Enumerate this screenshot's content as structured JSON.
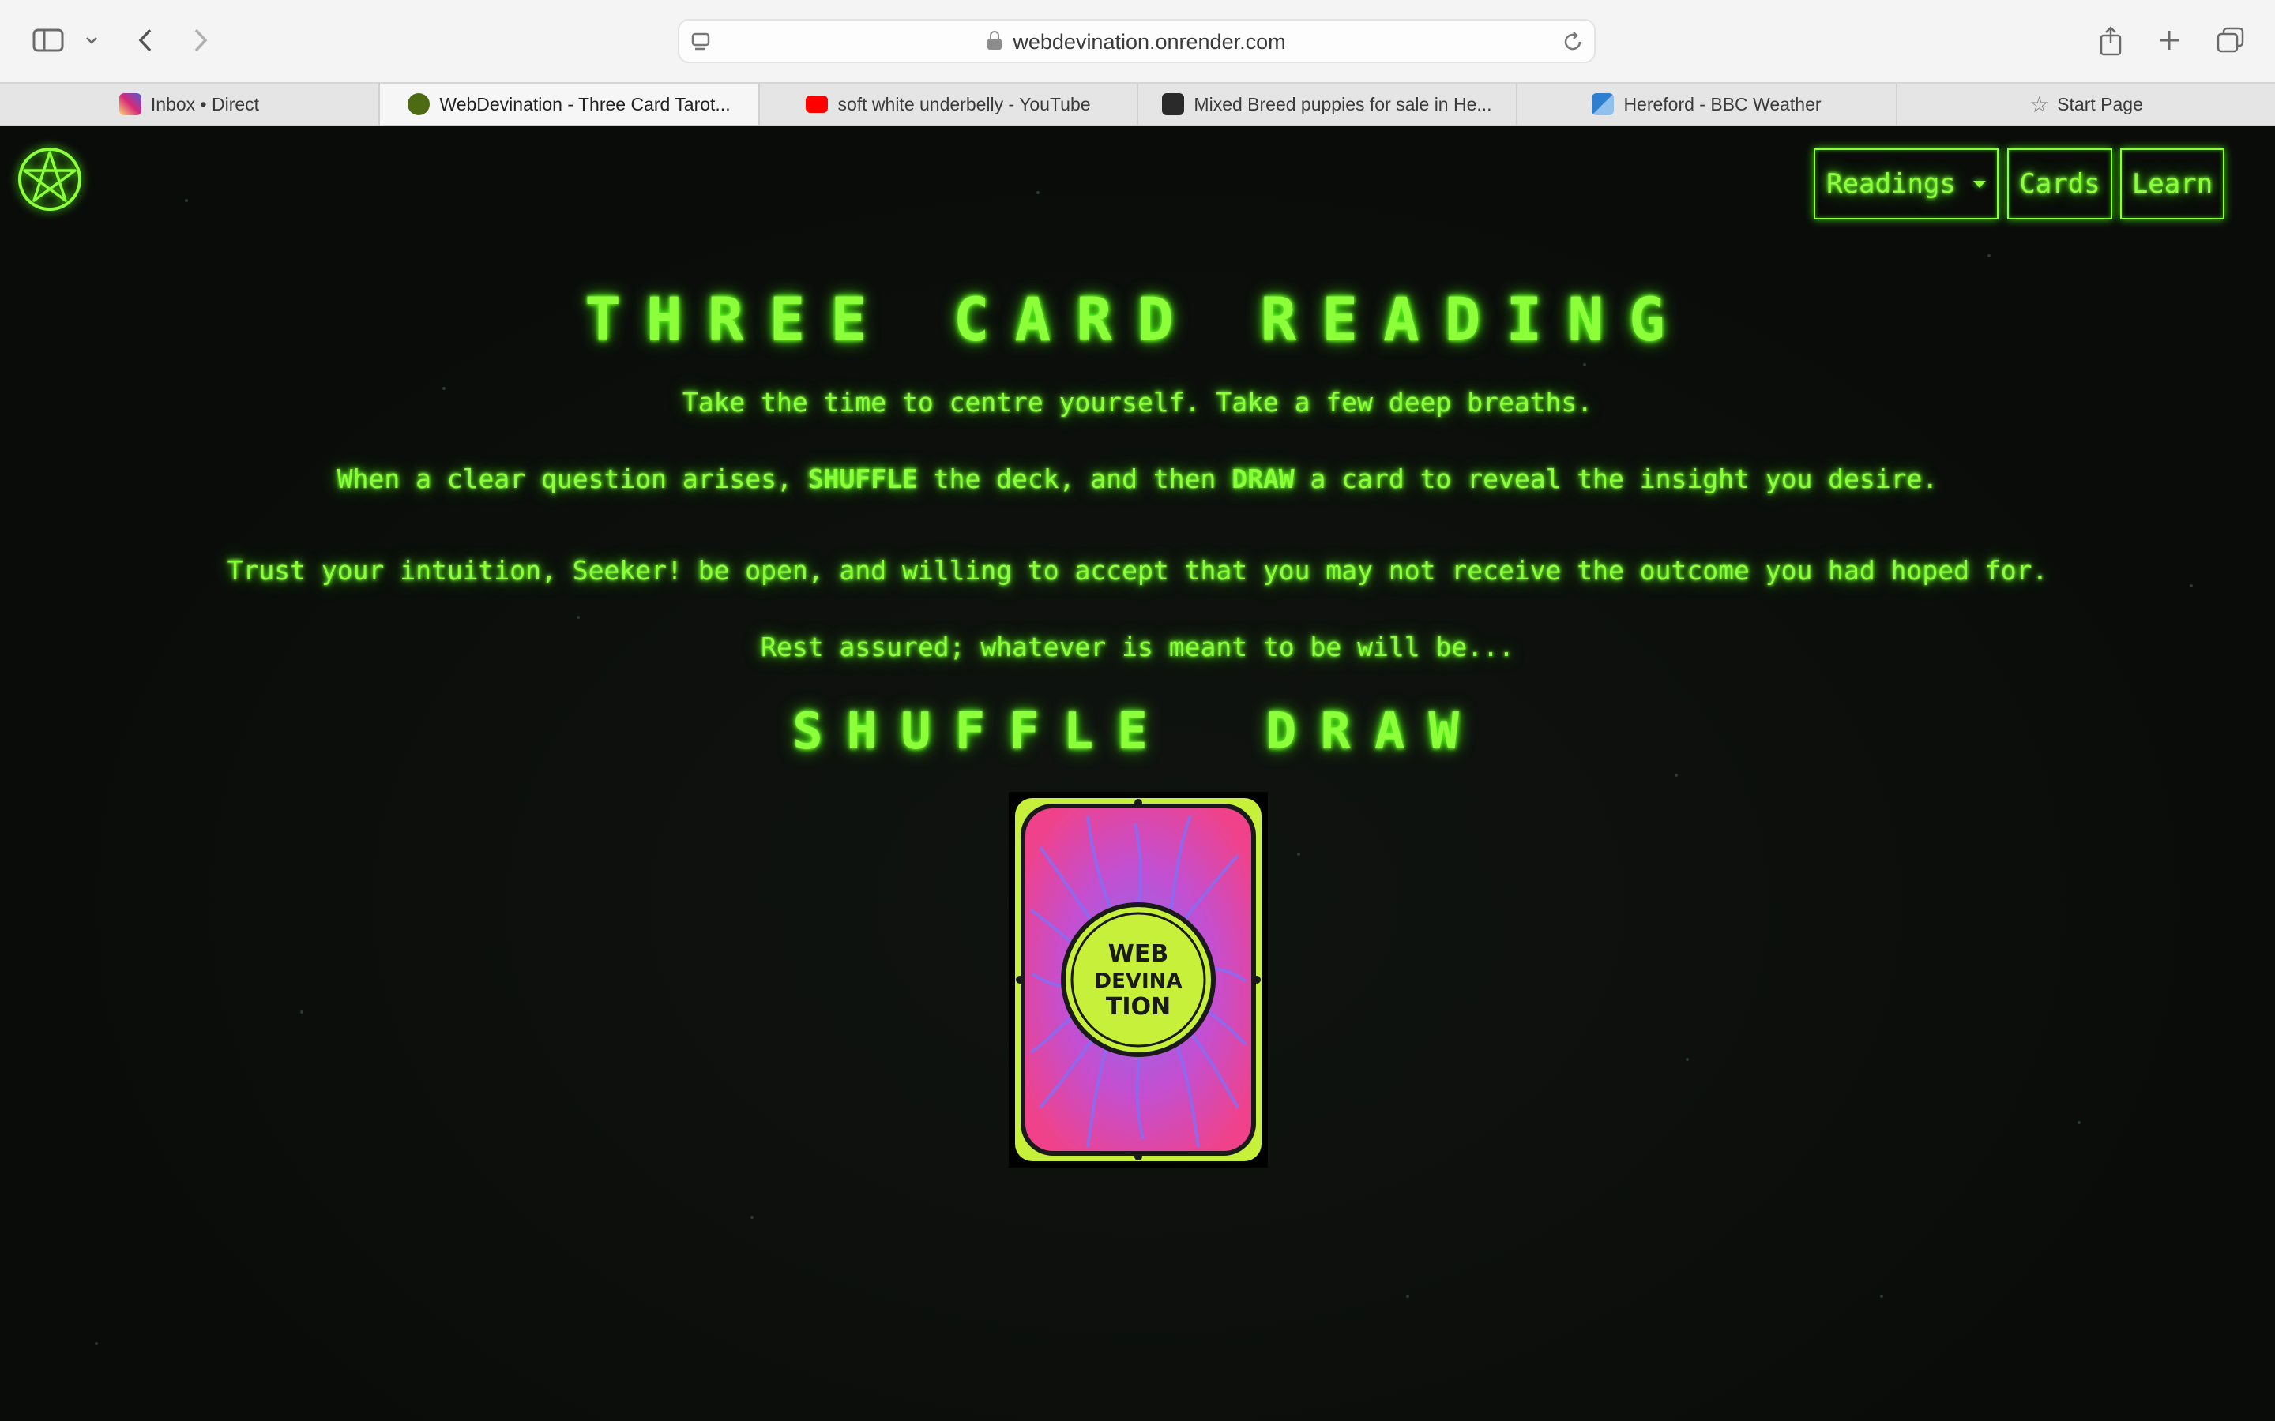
{
  "browser": {
    "url": "webdevination.onrender.com",
    "tabs": [
      {
        "title": "Inbox • Direct",
        "icon": "instagram-icon",
        "color": "#d6249f"
      },
      {
        "title": "WebDevination - Three Card Tarot...",
        "icon": "pentacle-favicon",
        "color": "#6b8f1a",
        "active": true
      },
      {
        "title": "soft white underbelly - YouTube",
        "icon": "youtube-icon",
        "color": "#ff0000"
      },
      {
        "title": "Mixed Breed puppies for sale in He...",
        "icon": "puppy-site-icon",
        "color": "#222222"
      },
      {
        "title": "Hereford - BBC Weather",
        "icon": "bbc-weather-icon",
        "color": "#2f7fd1"
      },
      {
        "title": "Start Page",
        "icon": "star-icon",
        "color": "#777777"
      }
    ]
  },
  "nav": {
    "readings": "Readings",
    "cards": "Cards",
    "learn": "Learn"
  },
  "page": {
    "title": "THREE CARD READING",
    "line1": "Take the time to centre yourself. Take a few deep breaths.",
    "line2_a": "When a clear question arises, ",
    "line2_shuffle": "SHUFFLE",
    "line2_b": " the deck, and then ",
    "line2_draw": "DRAW",
    "line2_c": " a card to reveal the insight you desire.",
    "line3": "Trust your intuition, Seeker! be open, and willing to accept that you may not receive the outcome you had hoped for.",
    "line4": "Rest assured; whatever is meant to be will be...",
    "shuffle_label": "SHUFFLE",
    "draw_label": "DRAW"
  },
  "deck": {
    "card_back_text": "WEB DEVINATION",
    "colors": {
      "pink": "#f0428a",
      "violet": "#8a6cf0",
      "lime": "#c7f03a"
    }
  },
  "theme": {
    "neon": "#8dff3a",
    "background": "#0b0d0b"
  }
}
